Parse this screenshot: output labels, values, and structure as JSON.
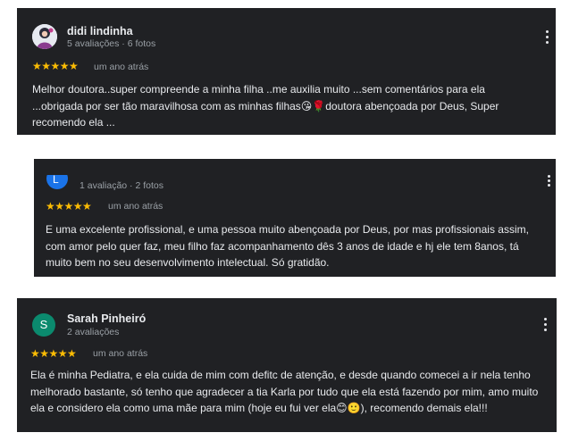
{
  "colors": {
    "card_background": "#202124",
    "star": "#fbbc04",
    "text": "#e8eaed",
    "muted": "#9aa0a6"
  },
  "reviews": [
    {
      "author": "didi lindinha",
      "meta": "5 avaliações · 6 fotos",
      "stars": "★★★★★",
      "rating": 5,
      "time": "um ano atrás",
      "text": "Melhor doutora..super compreende a minha filha ..me auxilia muito ...sem comentários para ela ...obrigada por ser tão maravilhosa com as minhas filhas😘🌹doutora abençoada por Deus, Super recomendo ela ..."
    },
    {
      "author": "",
      "avatar_letter": "L",
      "meta": "1 avaliação · 2 fotos",
      "stars": "★★★★★",
      "rating": 5,
      "time": "um ano atrás",
      "text": "E uma excelente profissional, e uma pessoa muito abençoada por Deus, por mas profissionais assim, com amor pelo quer faz, meu filho faz acompanhamento dês 3 anos de idade e hj ele tem 8anos, tá muito bem no seu desenvolvimento intelectual. Só gratidão."
    },
    {
      "author": "Sarah Pinheiró",
      "avatar_letter": "S",
      "meta": "2 avaliações",
      "stars": "★★★★★",
      "rating": 5,
      "time": "um ano atrás",
      "text": "Ela é minha Pediatra, e ela cuida de mim com defitc de atenção, e desde quando comecei a ir nela tenho melhorado bastante, só tenho que agradecer a tia Karla por tudo que ela está fazendo por mim, amo muito ela e considero ela como uma mãe para mim (hoje eu fui ver ela😊🙂), recomendo demais ela!!!"
    }
  ]
}
